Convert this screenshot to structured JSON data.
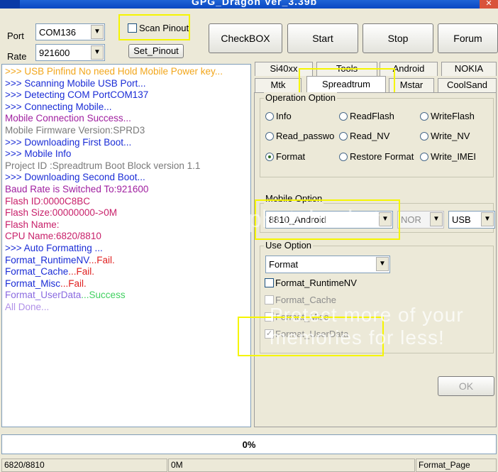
{
  "window": {
    "title": "GPG_Dragon Ver_3.39b"
  },
  "header": {
    "port_label": "Port",
    "port_value": "COM136",
    "rate_label": "Rate",
    "rate_value": "921600",
    "scan_pinout_label": "Scan Pinout",
    "set_pinout_label": "Set_Pinout"
  },
  "toolbar": {
    "checkbox_label": "CheckBOX",
    "start_label": "Start",
    "stop_label": "Stop",
    "forum_label": "Forum"
  },
  "log": {
    "lines": [
      {
        "text": ">>> USB Pinfind No need Hold Mobile Power key...",
        "color": "#f2a61b"
      },
      {
        "text": ">>> Scanning Mobile USB Port...",
        "color": "#1a2cd6"
      },
      {
        "text": ">>> Detecting COM PortCOM137",
        "color": "#1a2cd6"
      },
      {
        "text": ">>> Connecting Mobile...",
        "color": "#1a2cd6"
      },
      {
        "text": "  Mobile Connection Success...",
        "color": "#a020a0"
      },
      {
        "text": "  Mobile Firmware Version:SPRD3",
        "color": "#7a7a7a"
      },
      {
        "text": ">>> Downloading First Boot...",
        "color": "#1a2cd6"
      },
      {
        "text": ">>> Mobile Info",
        "color": "#1a2cd6"
      },
      {
        "text": "  Project ID :Spreadtrum Boot Block version 1.1",
        "color": "#7a7a7a"
      },
      {
        "text": ">>> Downloading Second Boot...",
        "color": "#1a2cd6"
      },
      {
        "text": "   Baud Rate is Switched To:921600",
        "color": "#a020a0"
      },
      {
        "text": "  Flash ID:0000C8BC",
        "color": "#c8206a"
      },
      {
        "text": "  Flash Size:00000000->0M",
        "color": "#c8206a"
      },
      {
        "text": "  Flash Name:",
        "color": "#c8206a"
      },
      {
        "text": "  CPU Name:6820/8810",
        "color": "#c8206a"
      },
      {
        "text": ">>> Auto Formatting ...",
        "color": "#1a2cd6"
      }
    ],
    "format_lines": [
      {
        "name": "  Format_RuntimeNV",
        "result": "...Fail.",
        "name_color": "#1a2cd6",
        "result_color": "#e02020"
      },
      {
        "name": "  Format_Cache",
        "result": "...Fail.",
        "name_color": "#1a2cd6",
        "result_color": "#e02020"
      },
      {
        "name": "  Format_Misc",
        "result": "...Fail.",
        "name_color": "#1a2cd6",
        "result_color": "#e02020"
      },
      {
        "name": "  Format_UserData",
        "result": "...Success",
        "name_color": "#8a6ae0",
        "result_color": "#40d060"
      }
    ],
    "final_line": {
      "text": "  All Done...",
      "color": "#b090e8"
    }
  },
  "tabs": {
    "row1": [
      "Si40xx",
      "Tools",
      "Android",
      "NOKIA"
    ],
    "row2": [
      "Mtk",
      "Spreadtrum",
      "Mstar",
      "CoolSand"
    ],
    "active": "Spreadtrum"
  },
  "operation": {
    "label": "Operation Option",
    "options": [
      "Info",
      "ReadFlash",
      "WriteFlash",
      "Read_passwo",
      "Read_NV",
      "Write_NV",
      "Format",
      "Restore Format",
      "Write_IMEI"
    ],
    "selected": "Format"
  },
  "mobile": {
    "label": "Mobile Option",
    "model_value": "8810_Android",
    "flash_value": "NOR",
    "interface_value": "USB"
  },
  "use": {
    "label": "Use Option",
    "select_value": "Format",
    "checks": [
      {
        "label": "Format_RuntimeNV",
        "checked": false,
        "enabled": true
      },
      {
        "label": "Format_Cache",
        "checked": false,
        "enabled": false
      },
      {
        "label": "Format_Misc",
        "checked": false,
        "enabled": false
      },
      {
        "label": "Format_UserData",
        "checked": true,
        "enabled": false
      }
    ],
    "ok_label": "OK"
  },
  "progress": {
    "percent_label": "0%",
    "value": 0
  },
  "statusbar": {
    "cpu": "6820/8810",
    "size": "0M",
    "page": "Format_Page"
  },
  "watermark": {
    "text": "Protect more of your memories for less!",
    "logo_text": "photobucket"
  }
}
